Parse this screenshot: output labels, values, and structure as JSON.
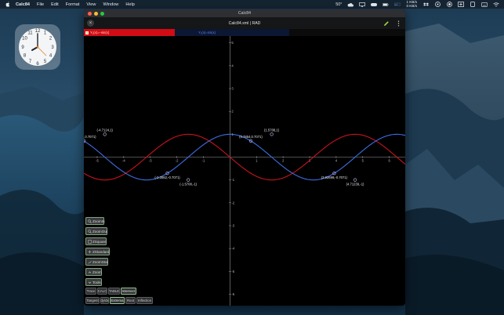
{
  "menubar": {
    "app_name": "Calc84",
    "menus": [
      "File",
      "Edit",
      "Format",
      "View",
      "Window",
      "Help"
    ],
    "temperature": "50°",
    "net_up": "1 KB/s",
    "net_down": "0 KB/s",
    "mem_label": "8.5 GB"
  },
  "window": {
    "title": "Calc84",
    "document_title": "Calc84.xml | RAD",
    "close_glyph": "×"
  },
  "expressions": [
    {
      "text": "Y₁(x)=−sin(x)",
      "color": "#d10c14"
    },
    {
      "text": "Y₂(x)=sin(x)",
      "color": "#3f6fe0"
    }
  ],
  "graph": {
    "x_ticks": [
      -6,
      -5,
      -4,
      -3,
      -2,
      -1,
      1,
      2,
      3,
      4,
      5,
      6
    ],
    "y_ticks": [
      5,
      4,
      3,
      2,
      1,
      -1,
      -2,
      -3,
      -4,
      -5,
      -6
    ],
    "x_range": [
      -5.5,
      6.6
    ],
    "y_range": [
      -6.5,
      5.3
    ],
    "curve_colors": {
      "red": "#c8141c",
      "blue": "#3d6ee3"
    },
    "annotations": [
      {
        "label": "(-6.2832,0.7071)",
        "x": -5.498,
        "y": 0.7071
      },
      {
        "label": "(-4.7124,1)",
        "x": -4.7124,
        "y": 1
      },
      {
        "label": "(-2.3562,-0.7071)",
        "x": -2.3562,
        "y": -0.7071
      },
      {
        "label": "(-1.5708,-1)",
        "x": -1.5708,
        "y": -1
      },
      {
        "label": "(0.7854,0.7071)",
        "x": 0.7854,
        "y": 0.7071
      },
      {
        "label": "(1.5708,1)",
        "x": 1.5708,
        "y": 1
      },
      {
        "label": "(3.92699,-0.7071)",
        "x": 3.927,
        "y": -0.7071
      },
      {
        "label": "(4.71239,-1)",
        "x": 4.7124,
        "y": -1
      }
    ]
  },
  "side_buttons": [
    {
      "label": "ZoomIn",
      "icon": "zoom-in-icon"
    },
    {
      "label": "ZoomOut",
      "icon": "zoom-out-icon"
    },
    {
      "label": "ZSquare",
      "icon": "zsquare-icon"
    },
    {
      "label": "ZStandard",
      "icon": "zstandard-icon"
    },
    {
      "label": "ZoomStat",
      "icon": "zoomstat-icon"
    },
    {
      "label": "Zoom",
      "icon": "chevron-up-icon"
    },
    {
      "label": "Tools",
      "icon": "chevron-down-icon"
    }
  ],
  "chips_row1": [
    {
      "label": "Trace",
      "active": false
    },
    {
      "label": "CALC",
      "active": false
    },
    {
      "label": "TABLE",
      "active": false
    },
    {
      "label": "Intersect",
      "active": true
    }
  ],
  "chips_row2": [
    {
      "label": "Tangent",
      "active": false
    },
    {
      "label": "dy/dx",
      "active": false
    },
    {
      "label": "Extrema",
      "active": true
    },
    {
      "label": "Root",
      "active": false
    },
    {
      "label": "Inflection",
      "active": false
    }
  ]
}
